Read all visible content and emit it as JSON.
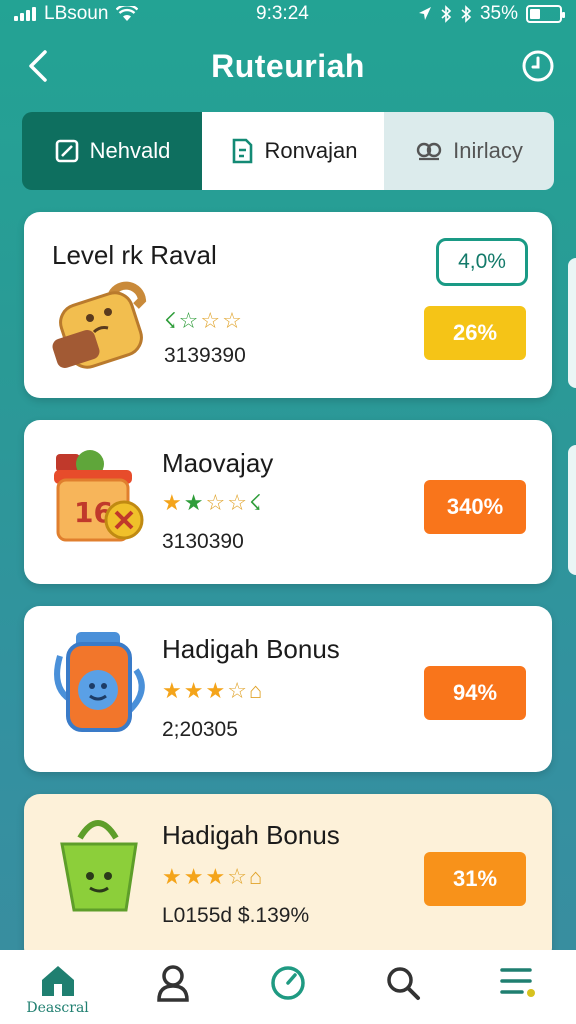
{
  "status_bar": {
    "carrier": "LBsoun",
    "time": "9:3:24",
    "battery": "35%"
  },
  "header": {
    "title": "Ruteuriah"
  },
  "tabs": [
    {
      "label": "Nehvald"
    },
    {
      "label": "Ronvajan"
    },
    {
      "label": "Inirlacy"
    }
  ],
  "cards": [
    {
      "title": "Level rk Raval",
      "stars_text": "ᴓ ☆☆☆",
      "value": "3139390",
      "badge": "4,0%",
      "percent": "26%",
      "percent_color": "#f5c417"
    },
    {
      "title": "Maovajay",
      "value": "3130390",
      "percent": "340%",
      "percent_color": "#f9751b"
    },
    {
      "title": "Hadigah Bonus",
      "value": "2;20305",
      "percent": "94%",
      "percent_color": "#f9751b"
    },
    {
      "title": "Hadigah Bonus",
      "value": "L0155d $.139%",
      "percent": "31%",
      "percent_color": "#f8921a"
    }
  ],
  "bottom_nav": {
    "items": [
      {
        "label": "Deascral",
        "icon": "home-icon"
      },
      {
        "label": "",
        "icon": "user-icon"
      },
      {
        "label": "",
        "icon": "gauge-icon"
      },
      {
        "label": "",
        "icon": "search-icon"
      },
      {
        "label": "",
        "icon": "menu-icon"
      }
    ]
  },
  "colors": {
    "accent": "#0e6f5f",
    "background_top": "#23a394",
    "badge_outline": "#1a9a85"
  }
}
